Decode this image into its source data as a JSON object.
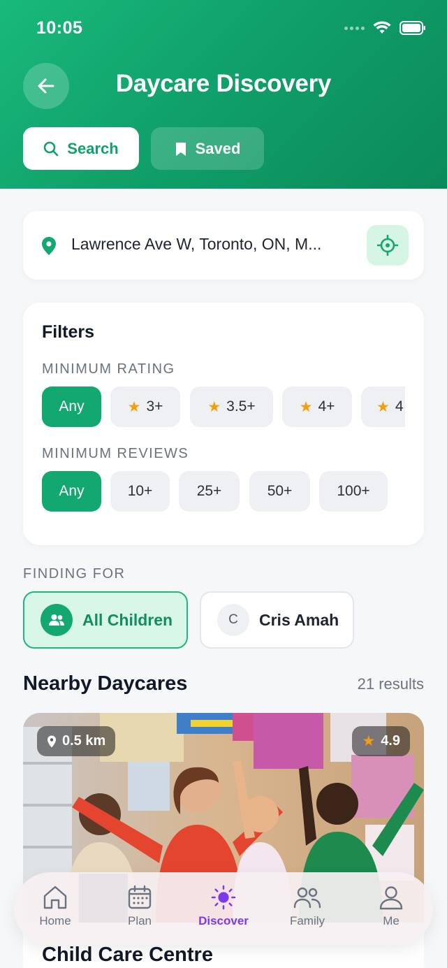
{
  "status_bar": {
    "time": "10:05"
  },
  "header": {
    "title": "Daycare Discovery"
  },
  "tabs": [
    {
      "label": "Search",
      "icon": "search-icon"
    },
    {
      "label": "Saved",
      "icon": "bookmark-icon"
    }
  ],
  "location": {
    "address": "Lawrence Ave W, Toronto, ON, M...",
    "icon": "map-pin-icon"
  },
  "filters": {
    "title": "Filters",
    "rating_label": "MINIMUM RATING",
    "rating_options": [
      "Any",
      "3+",
      "3.5+",
      "4+",
      "4"
    ],
    "reviews_label": "MINIMUM REVIEWS",
    "review_options": [
      "Any",
      "10+",
      "25+",
      "50+",
      "100+"
    ]
  },
  "finding_for": {
    "label": "FINDING FOR",
    "options": [
      {
        "label": "All Children",
        "selected": true
      },
      {
        "label": "Cris Amah",
        "initial": "C",
        "selected": false
      }
    ]
  },
  "nearby": {
    "title": "Nearby Daycares",
    "results": "21 results",
    "card": {
      "distance": "0.5 km",
      "rating": "4.9",
      "name": "Child Care Centre"
    }
  },
  "bottom_nav": {
    "items": [
      {
        "label": "Home",
        "icon": "home-icon"
      },
      {
        "label": "Plan",
        "icon": "calendar-icon"
      },
      {
        "label": "Discover",
        "icon": "sun-icon",
        "active": true
      },
      {
        "label": "Family",
        "icon": "family-icon"
      },
      {
        "label": "Me",
        "icon": "user-icon"
      }
    ]
  },
  "colors": {
    "primary": "#12a870",
    "accent": "#7c3aed",
    "star": "#f59e0b"
  }
}
